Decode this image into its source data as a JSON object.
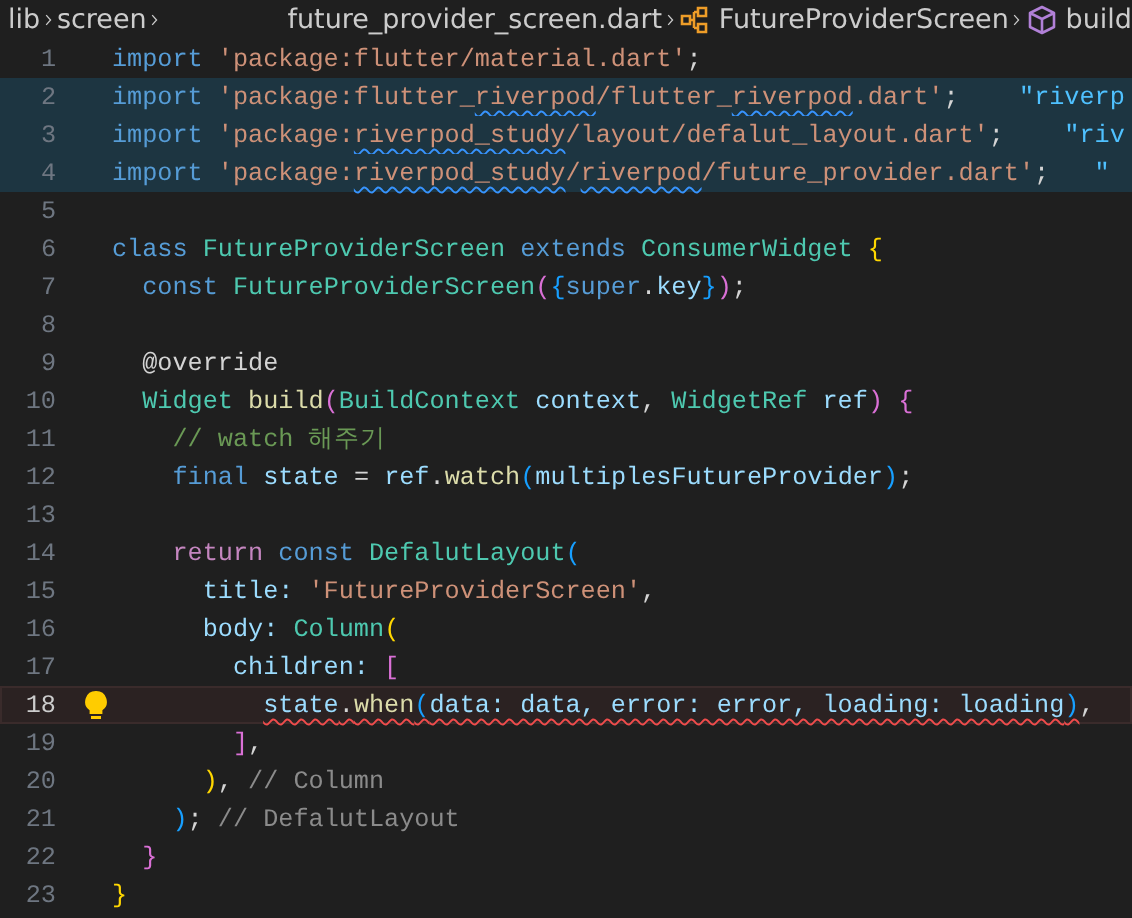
{
  "breadcrumb": [
    {
      "text": "lib",
      "kind": "folder"
    },
    {
      "text": "screen",
      "kind": "folder"
    },
    {
      "text": "future_provider_screen.dart",
      "kind": "file"
    },
    {
      "text": "FutureProviderScreen",
      "kind": "class"
    },
    {
      "text": "build",
      "kind": "method"
    }
  ],
  "lines": [
    {
      "number": "1",
      "selected": false,
      "current": false,
      "lightbulb": false,
      "tokens": [
        {
          "text": "import ",
          "kind": "keyword"
        },
        {
          "text": "'package:flutter/material.dart'",
          "kind": "string"
        },
        {
          "text": ";",
          "kind": "punct"
        }
      ]
    },
    {
      "number": "2",
      "selected": true,
      "current": false,
      "lightbulb": false,
      "tokens": [
        {
          "text": "import ",
          "kind": "keyword"
        },
        {
          "text": "'package:flutter_",
          "kind": "string"
        },
        {
          "text": "riverpod",
          "kind": "string",
          "info": true
        },
        {
          "text": "/flutter_",
          "kind": "string"
        },
        {
          "text": "riverpod",
          "kind": "string",
          "info": true
        },
        {
          "text": ".dart'",
          "kind": "string"
        },
        {
          "text": ";",
          "kind": "punct"
        },
        {
          "text": "    \"riverp",
          "kind": "hint"
        }
      ]
    },
    {
      "number": "3",
      "selected": true,
      "current": false,
      "lightbulb": false,
      "tokens": [
        {
          "text": "import ",
          "kind": "keyword"
        },
        {
          "text": "'package:",
          "kind": "string"
        },
        {
          "text": "riverpod_study",
          "kind": "string",
          "info": true
        },
        {
          "text": "/layout/defalut_layout.dart'",
          "kind": "string"
        },
        {
          "text": ";",
          "kind": "punct"
        },
        {
          "text": "    \"riv",
          "kind": "hint"
        }
      ]
    },
    {
      "number": "4",
      "selected": true,
      "current": false,
      "lightbulb": false,
      "tokens": [
        {
          "text": "import ",
          "kind": "keyword"
        },
        {
          "text": "'package:",
          "kind": "string"
        },
        {
          "text": "riverpod_study",
          "kind": "string",
          "info": true
        },
        {
          "text": "/",
          "kind": "string"
        },
        {
          "text": "riverpod",
          "kind": "string",
          "info": true
        },
        {
          "text": "/future_provider.dart'",
          "kind": "string"
        },
        {
          "text": ";",
          "kind": "punct"
        },
        {
          "text": "   \"",
          "kind": "hint"
        }
      ]
    },
    {
      "number": "5",
      "selected": false,
      "current": false,
      "lightbulb": false
    },
    {
      "number": "6",
      "selected": false,
      "current": false,
      "lightbulb": false,
      "tokens": [
        {
          "text": "class ",
          "kind": "keyword"
        },
        {
          "text": "FutureProviderScreen ",
          "kind": "type"
        },
        {
          "text": "extends ",
          "kind": "keyword"
        },
        {
          "text": "ConsumerWidget ",
          "kind": "type"
        },
        {
          "text": "{",
          "kind": "bracket1"
        }
      ]
    },
    {
      "number": "7",
      "selected": false,
      "current": false,
      "lightbulb": false,
      "tokens": [
        {
          "text": "  const ",
          "kind": "keyword"
        },
        {
          "text": "FutureProviderScreen",
          "kind": "type"
        },
        {
          "text": "(",
          "kind": "bracket2"
        },
        {
          "text": "{",
          "kind": "bracket3"
        },
        {
          "text": "super",
          "kind": "keyword"
        },
        {
          "text": ".",
          "kind": "punct"
        },
        {
          "text": "key",
          "kind": "variable"
        },
        {
          "text": "}",
          "kind": "bracket3"
        },
        {
          "text": ")",
          "kind": "bracket2"
        },
        {
          "text": ";",
          "kind": "punct"
        }
      ]
    },
    {
      "number": "8",
      "selected": false,
      "current": false,
      "lightbulb": false
    },
    {
      "number": "9",
      "selected": false,
      "current": false,
      "lightbulb": false,
      "tokens": [
        {
          "text": "  @override",
          "kind": "punct"
        }
      ]
    },
    {
      "number": "10",
      "selected": false,
      "current": false,
      "lightbulb": false,
      "tokens": [
        {
          "text": "  Widget ",
          "kind": "type"
        },
        {
          "text": "build",
          "kind": "function"
        },
        {
          "text": "(",
          "kind": "bracket2"
        },
        {
          "text": "BuildContext ",
          "kind": "type"
        },
        {
          "text": "context",
          "kind": "variable"
        },
        {
          "text": ", ",
          "kind": "punct"
        },
        {
          "text": "WidgetRef ",
          "kind": "type"
        },
        {
          "text": "ref",
          "kind": "variable"
        },
        {
          "text": ") ",
          "kind": "bracket2"
        },
        {
          "text": "{",
          "kind": "bracket2"
        }
      ]
    },
    {
      "number": "11",
      "selected": false,
      "current": false,
      "lightbulb": false,
      "tokens": [
        {
          "text": "    // watch 해주기",
          "kind": "comment"
        }
      ]
    },
    {
      "number": "12",
      "selected": false,
      "current": false,
      "lightbulb": false,
      "tokens": [
        {
          "text": "    final ",
          "kind": "keyword"
        },
        {
          "text": "state ",
          "kind": "variable"
        },
        {
          "text": "= ",
          "kind": "punct"
        },
        {
          "text": "ref",
          "kind": "variable"
        },
        {
          "text": ".",
          "kind": "punct"
        },
        {
          "text": "watch",
          "kind": "function"
        },
        {
          "text": "(",
          "kind": "bracket3"
        },
        {
          "text": "multiplesFutureProvider",
          "kind": "variable"
        },
        {
          "text": ")",
          "kind": "bracket3"
        },
        {
          "text": ";",
          "kind": "punct"
        }
      ]
    },
    {
      "number": "13",
      "selected": false,
      "current": false,
      "lightbulb": false
    },
    {
      "number": "14",
      "selected": false,
      "current": false,
      "lightbulb": false,
      "tokens": [
        {
          "text": "    return ",
          "kind": "control"
        },
        {
          "text": "const ",
          "kind": "keyword"
        },
        {
          "text": "DefalutLayout",
          "kind": "type"
        },
        {
          "text": "(",
          "kind": "bracket3"
        }
      ]
    },
    {
      "number": "15",
      "selected": false,
      "current": false,
      "lightbulb": false,
      "tokens": [
        {
          "text": "      title: ",
          "kind": "variable"
        },
        {
          "text": "'FutureProviderScreen'",
          "kind": "string"
        },
        {
          "text": ",",
          "kind": "punct"
        }
      ]
    },
    {
      "number": "16",
      "selected": false,
      "current": false,
      "lightbulb": false,
      "tokens": [
        {
          "text": "      body: ",
          "kind": "variable"
        },
        {
          "text": "Column",
          "kind": "type"
        },
        {
          "text": "(",
          "kind": "bracket1"
        }
      ]
    },
    {
      "number": "17",
      "selected": false,
      "current": false,
      "lightbulb": false,
      "tokens": [
        {
          "text": "        children: ",
          "kind": "variable"
        },
        {
          "text": "[",
          "kind": "bracket2"
        }
      ]
    },
    {
      "number": "18",
      "selected": false,
      "current": true,
      "lightbulb": true,
      "tokens": [
        {
          "text": "          state",
          "kind": "variable",
          "error": true
        },
        {
          "text": ".",
          "kind": "punct",
          "error": true
        },
        {
          "text": "when",
          "kind": "function",
          "error": true
        },
        {
          "text": "(",
          "kind": "bracket3",
          "error": true
        },
        {
          "text": "data: data, error: error, loading: loading",
          "kind": "variable",
          "error": true
        },
        {
          "text": ")",
          "kind": "bracket3",
          "error": true
        },
        {
          "text": ",",
          "kind": "punct"
        }
      ]
    },
    {
      "number": "19",
      "selected": false,
      "current": false,
      "lightbulb": false,
      "tokens": [
        {
          "text": "        ]",
          "kind": "bracket2"
        },
        {
          "text": ",",
          "kind": "punct"
        }
      ]
    },
    {
      "number": "20",
      "selected": false,
      "current": false,
      "lightbulb": false,
      "tokens": [
        {
          "text": "      )",
          "kind": "bracket1"
        },
        {
          "text": ", ",
          "kind": "punct"
        },
        {
          "text": "// Column",
          "kind": "label"
        }
      ]
    },
    {
      "number": "21",
      "selected": false,
      "current": false,
      "lightbulb": false,
      "tokens": [
        {
          "text": "    )",
          "kind": "bracket3"
        },
        {
          "text": "; ",
          "kind": "punct"
        },
        {
          "text": "// DefalutLayout",
          "kind": "label"
        }
      ]
    },
    {
      "number": "22",
      "selected": false,
      "current": false,
      "lightbulb": false,
      "tokens": [
        {
          "text": "  }",
          "kind": "bracket2"
        }
      ]
    },
    {
      "number": "23",
      "selected": false,
      "current": false,
      "lightbulb": false,
      "tokens": [
        {
          "text": "}",
          "kind": "bracket1"
        }
      ]
    }
  ]
}
